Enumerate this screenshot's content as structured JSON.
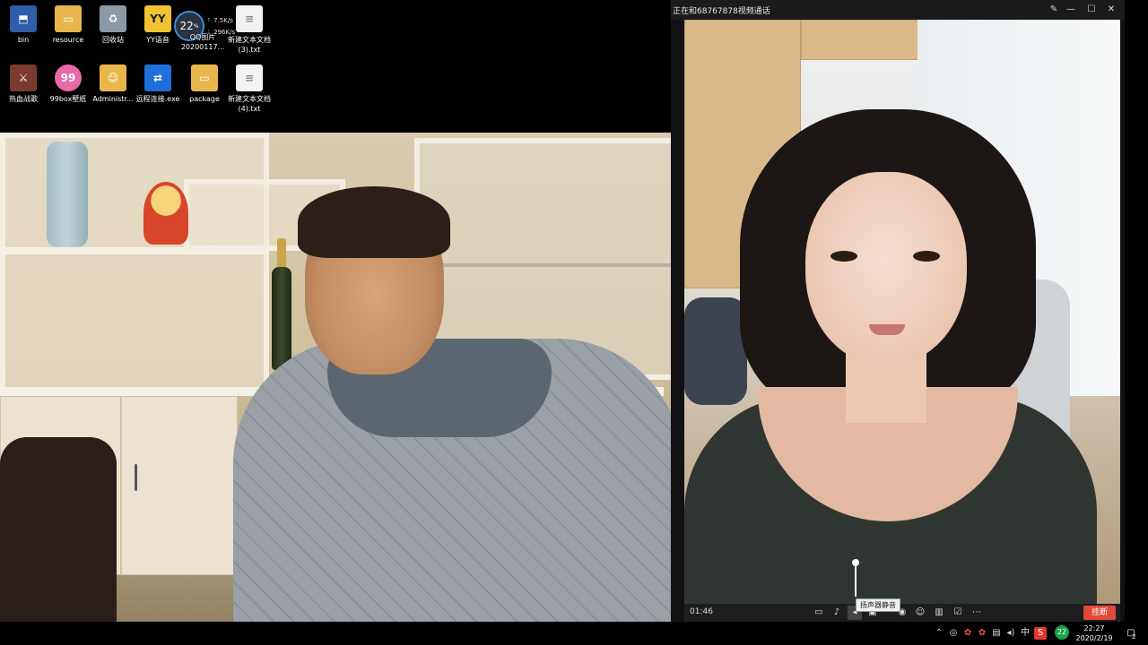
{
  "desktop": {
    "icons": [
      {
        "label": "bin",
        "icon": "recycle-folder-icon",
        "color": "#2f5ea8"
      },
      {
        "label": "resource",
        "icon": "folder-icon",
        "color": "#e8b64c"
      },
      {
        "label": "回收站",
        "icon": "recycle-bin-icon",
        "color": "#8b9aa5"
      },
      {
        "label": "YY语音",
        "icon": "yy-voice-icon",
        "color": "#f1c232"
      },
      {
        "label": "",
        "icon": "speed-widget",
        "color": "#2a3340"
      },
      {
        "label": "新建文本文档 (3).txt",
        "icon": "text-file-icon",
        "color": "#f2f2f2"
      },
      {
        "label": "热血战歌",
        "icon": "game-icon",
        "color": "#7a3b2e"
      },
      {
        "label": "99box壁纸",
        "icon": "wallpaper-app-icon",
        "color": "#e86aa6"
      },
      {
        "label": "Administr...",
        "icon": "user-folder-icon",
        "color": "#e8b64c"
      },
      {
        "label": "远程连接.exe",
        "icon": "teamviewer-icon",
        "color": "#1e6fd9"
      },
      {
        "label": "package",
        "icon": "package-folder-icon",
        "color": "#e8b64c"
      },
      {
        "label": "新建文本文档 (4).txt",
        "icon": "text-file-icon",
        "color": "#f2f2f2"
      }
    ],
    "speed_widget": {
      "value": "22",
      "unit": "%",
      "upload": "7.5K/s",
      "download": "296K/s",
      "under_label_1": "QQ图片",
      "under_label_2": "20200117..."
    }
  },
  "call_window": {
    "title": "正在和68767878视频通话",
    "elapsed": "01:46",
    "hangup_label": "挂断",
    "tooltip": "扬声器静音",
    "volume_level": 0.95,
    "toolbar_icons": [
      "chat-icon",
      "microphone-icon",
      "speaker-icon",
      "screen-share-icon",
      "camera-icon",
      "effects-icon",
      "layout-icon",
      "whiteboard-icon",
      "more-icon"
    ],
    "titlebar_icons": [
      "pin-icon",
      "minimize-icon",
      "maximize-icon",
      "close-icon"
    ]
  },
  "taskbar": {
    "time": "22:27",
    "date": "2020/2/19",
    "ime": "中",
    "badge": "22",
    "notification_count": "2"
  },
  "colors": {
    "hangup": "#e04a3c",
    "titlebar": "#1b1b1b",
    "accent_blue": "#3a8edb"
  }
}
